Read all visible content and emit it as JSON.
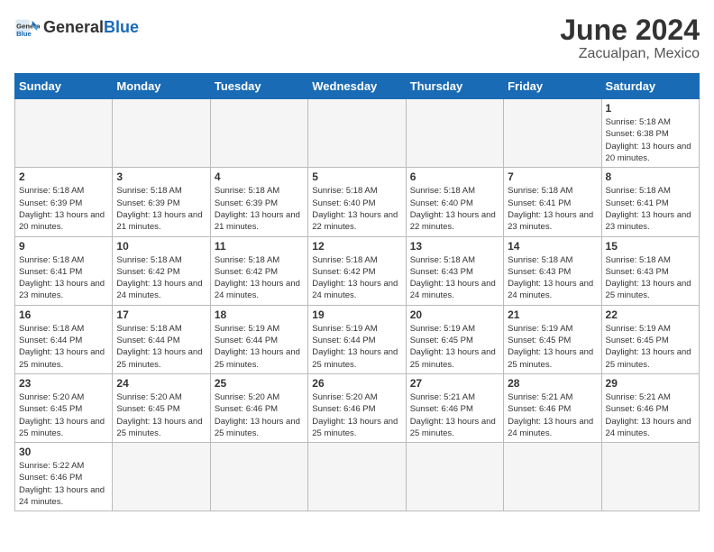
{
  "header": {
    "logo_general": "General",
    "logo_blue": "Blue",
    "month_title": "June 2024",
    "location": "Zacualpan, Mexico"
  },
  "days_of_week": [
    "Sunday",
    "Monday",
    "Tuesday",
    "Wednesday",
    "Thursday",
    "Friday",
    "Saturday"
  ],
  "weeks": [
    [
      {
        "day": "",
        "empty": true
      },
      {
        "day": "",
        "empty": true
      },
      {
        "day": "",
        "empty": true
      },
      {
        "day": "",
        "empty": true
      },
      {
        "day": "",
        "empty": true
      },
      {
        "day": "",
        "empty": true
      },
      {
        "day": "1",
        "sunrise": "5:18 AM",
        "sunset": "6:38 PM",
        "daylight": "13 hours and 20 minutes."
      }
    ],
    [
      {
        "day": "2",
        "sunrise": "5:18 AM",
        "sunset": "6:39 PM",
        "daylight": "13 hours and 20 minutes."
      },
      {
        "day": "3",
        "sunrise": "5:18 AM",
        "sunset": "6:39 PM",
        "daylight": "13 hours and 21 minutes."
      },
      {
        "day": "4",
        "sunrise": "5:18 AM",
        "sunset": "6:39 PM",
        "daylight": "13 hours and 21 minutes."
      },
      {
        "day": "5",
        "sunrise": "5:18 AM",
        "sunset": "6:40 PM",
        "daylight": "13 hours and 22 minutes."
      },
      {
        "day": "6",
        "sunrise": "5:18 AM",
        "sunset": "6:40 PM",
        "daylight": "13 hours and 22 minutes."
      },
      {
        "day": "7",
        "sunrise": "5:18 AM",
        "sunset": "6:41 PM",
        "daylight": "13 hours and 23 minutes."
      },
      {
        "day": "8",
        "sunrise": "5:18 AM",
        "sunset": "6:41 PM",
        "daylight": "13 hours and 23 minutes."
      }
    ],
    [
      {
        "day": "9",
        "sunrise": "5:18 AM",
        "sunset": "6:41 PM",
        "daylight": "13 hours and 23 minutes."
      },
      {
        "day": "10",
        "sunrise": "5:18 AM",
        "sunset": "6:42 PM",
        "daylight": "13 hours and 24 minutes."
      },
      {
        "day": "11",
        "sunrise": "5:18 AM",
        "sunset": "6:42 PM",
        "daylight": "13 hours and 24 minutes."
      },
      {
        "day": "12",
        "sunrise": "5:18 AM",
        "sunset": "6:42 PM",
        "daylight": "13 hours and 24 minutes."
      },
      {
        "day": "13",
        "sunrise": "5:18 AM",
        "sunset": "6:43 PM",
        "daylight": "13 hours and 24 minutes."
      },
      {
        "day": "14",
        "sunrise": "5:18 AM",
        "sunset": "6:43 PM",
        "daylight": "13 hours and 24 minutes."
      },
      {
        "day": "15",
        "sunrise": "5:18 AM",
        "sunset": "6:43 PM",
        "daylight": "13 hours and 25 minutes."
      }
    ],
    [
      {
        "day": "16",
        "sunrise": "5:18 AM",
        "sunset": "6:44 PM",
        "daylight": "13 hours and 25 minutes."
      },
      {
        "day": "17",
        "sunrise": "5:18 AM",
        "sunset": "6:44 PM",
        "daylight": "13 hours and 25 minutes."
      },
      {
        "day": "18",
        "sunrise": "5:19 AM",
        "sunset": "6:44 PM",
        "daylight": "13 hours and 25 minutes."
      },
      {
        "day": "19",
        "sunrise": "5:19 AM",
        "sunset": "6:44 PM",
        "daylight": "13 hours and 25 minutes."
      },
      {
        "day": "20",
        "sunrise": "5:19 AM",
        "sunset": "6:45 PM",
        "daylight": "13 hours and 25 minutes."
      },
      {
        "day": "21",
        "sunrise": "5:19 AM",
        "sunset": "6:45 PM",
        "daylight": "13 hours and 25 minutes."
      },
      {
        "day": "22",
        "sunrise": "5:19 AM",
        "sunset": "6:45 PM",
        "daylight": "13 hours and 25 minutes."
      }
    ],
    [
      {
        "day": "23",
        "sunrise": "5:20 AM",
        "sunset": "6:45 PM",
        "daylight": "13 hours and 25 minutes."
      },
      {
        "day": "24",
        "sunrise": "5:20 AM",
        "sunset": "6:45 PM",
        "daylight": "13 hours and 25 minutes."
      },
      {
        "day": "25",
        "sunrise": "5:20 AM",
        "sunset": "6:46 PM",
        "daylight": "13 hours and 25 minutes."
      },
      {
        "day": "26",
        "sunrise": "5:20 AM",
        "sunset": "6:46 PM",
        "daylight": "13 hours and 25 minutes."
      },
      {
        "day": "27",
        "sunrise": "5:21 AM",
        "sunset": "6:46 PM",
        "daylight": "13 hours and 25 minutes."
      },
      {
        "day": "28",
        "sunrise": "5:21 AM",
        "sunset": "6:46 PM",
        "daylight": "13 hours and 24 minutes."
      },
      {
        "day": "29",
        "sunrise": "5:21 AM",
        "sunset": "6:46 PM",
        "daylight": "13 hours and 24 minutes."
      }
    ],
    [
      {
        "day": "30",
        "sunrise": "5:22 AM",
        "sunset": "6:46 PM",
        "daylight": "13 hours and 24 minutes."
      },
      {
        "day": "",
        "empty": true
      },
      {
        "day": "",
        "empty": true
      },
      {
        "day": "",
        "empty": true
      },
      {
        "day": "",
        "empty": true
      },
      {
        "day": "",
        "empty": true
      },
      {
        "day": "",
        "empty": true
      }
    ]
  ],
  "labels": {
    "sunrise_prefix": "Sunrise: ",
    "sunset_prefix": "Sunset: ",
    "daylight_prefix": "Daylight: "
  }
}
